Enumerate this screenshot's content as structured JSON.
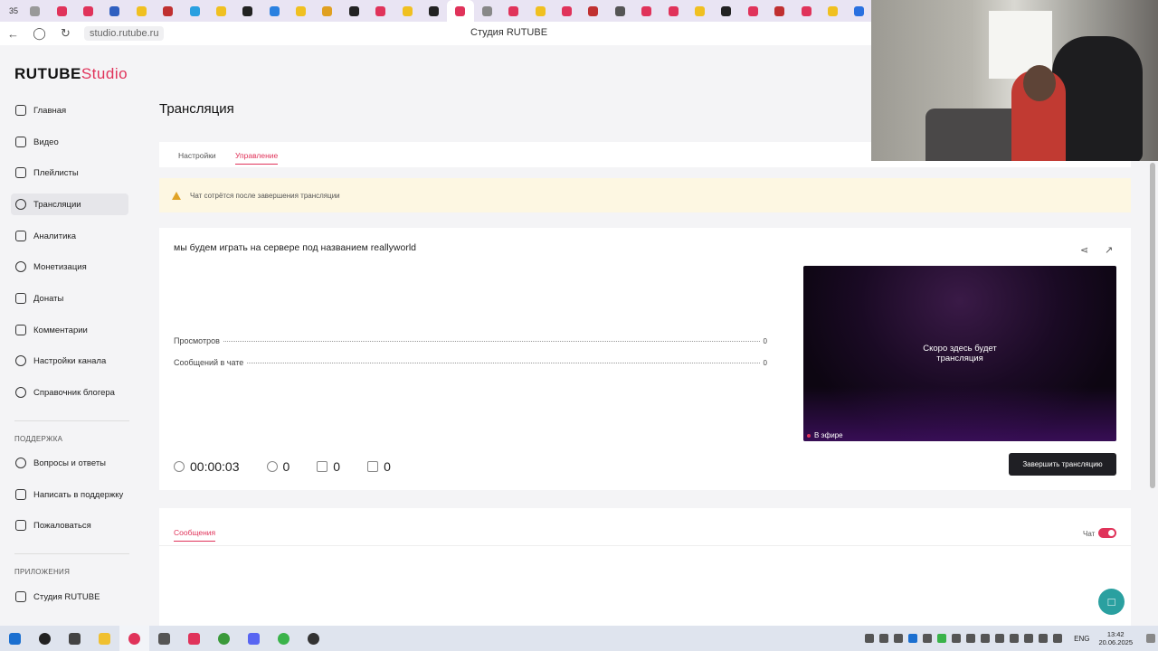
{
  "browser": {
    "tab_count": "35",
    "page_title": "Студия RUTUBE",
    "url": "studio.rutube.ru"
  },
  "sidebar": {
    "logo_main": "RUTUBE",
    "logo_studio": "Studio",
    "items": [
      {
        "label": "Главная",
        "icon": "home-icon"
      },
      {
        "label": "Видео",
        "icon": "video-icon"
      },
      {
        "label": "Плейлисты",
        "icon": "playlist-icon"
      },
      {
        "label": "Трансляции",
        "icon": "broadcast-icon"
      },
      {
        "label": "Аналитика",
        "icon": "analytics-icon"
      },
      {
        "label": "Монетизация",
        "icon": "monetization-icon"
      },
      {
        "label": "Донаты",
        "icon": "donations-icon"
      },
      {
        "label": "Комментарии",
        "icon": "comments-icon"
      },
      {
        "label": "Настройки канала",
        "icon": "settings-icon"
      },
      {
        "label": "Справочник блогера",
        "icon": "guide-icon"
      }
    ],
    "support_section": "ПОДДЕРЖКА",
    "support_items": [
      {
        "label": "Вопросы и ответы",
        "icon": "faq-icon"
      },
      {
        "label": "Написать в поддержку",
        "icon": "mail-icon"
      },
      {
        "label": "Пожаловаться",
        "icon": "flag-icon"
      }
    ],
    "apps_section": "ПРИЛОЖЕНИЯ",
    "apps_items": [
      {
        "label": "Студия RUTUBE",
        "icon": "studio-app-icon"
      }
    ]
  },
  "main": {
    "title": "Трансляция",
    "tabs": [
      {
        "label": "Настройки"
      },
      {
        "label": "Управление"
      }
    ],
    "warning": "Чат сотрётся после завершения трансляции",
    "stream": {
      "title": "мы будем играть на сервере под названием reallyworld",
      "views_label": "Просмотров",
      "views_value": "0",
      "chat_label": "Сообщений в чате",
      "chat_value": "0",
      "duration": "00:00:03",
      "viewers": "0",
      "likes": "0",
      "dislikes": "0",
      "preview_text_1": "Скоро здесь будет",
      "preview_text_2": "трансляция",
      "live_label": "В эфире",
      "end_button": "Завершить трансляцию"
    },
    "messages": {
      "tab": "Сообщения",
      "chat_label": "Чат",
      "chat_enabled": true
    }
  },
  "taskbar": {
    "lang": "ENG",
    "time": "13:42",
    "date": "20.06.2025"
  },
  "colors": {
    "accent": "#e0335a",
    "warning_bg": "#fdf7e2",
    "button_dark": "#1f1f24"
  }
}
